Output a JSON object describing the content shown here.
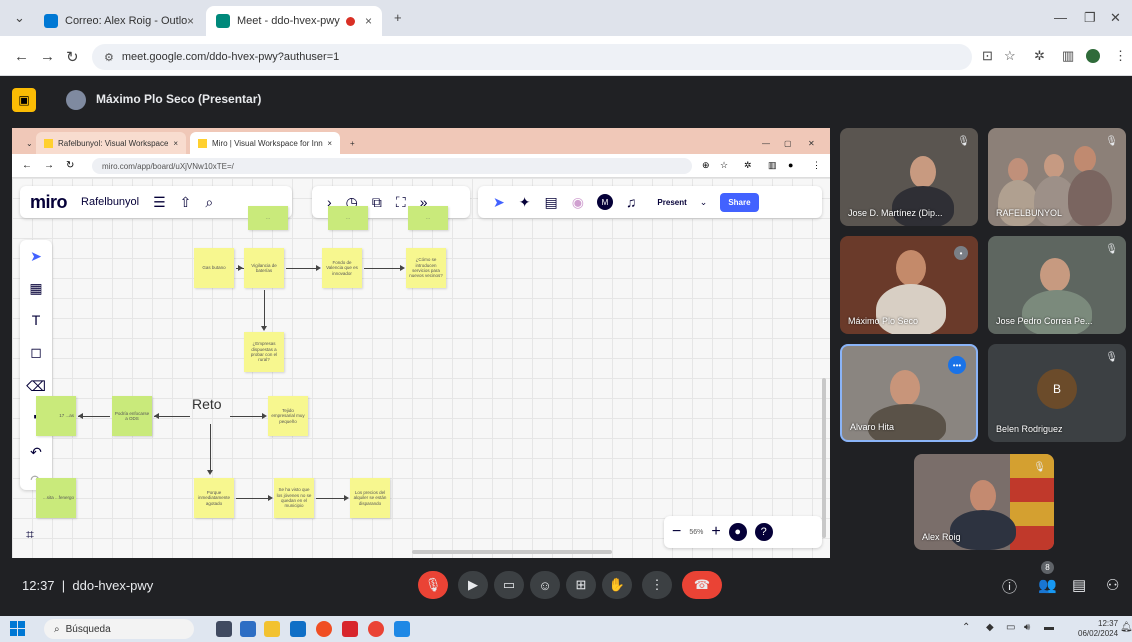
{
  "chrome": {
    "tabs": [
      {
        "label": "Correo: Alex Roig - Outlook",
        "favicon_color": "#0078d4"
      },
      {
        "label": "Meet - ddo-hvex-pwy",
        "favicon_color": "#00897b"
      }
    ],
    "new_tab": "+",
    "url": "meet.google.com/ddo-hvex-pwy?authuser=1",
    "site_info_icon": "tune-icon"
  },
  "meet": {
    "presenter_label": "Máximo Plo Seco (Presentar)",
    "meeting_time": "12:37",
    "meeting_code": "ddo-hvex-pwy",
    "people_count": "8",
    "colors": {
      "background": "#202124",
      "end_call": "#ea4335",
      "speaking": "#1a73e8"
    }
  },
  "shared_screen": {
    "inner_tabs": [
      {
        "label": "Rafelbunyol: Visual Workspace"
      },
      {
        "label": "Miro | Visual Workspace for Inn"
      }
    ],
    "inner_url": "miro.com/app/board/uXjVNw10xTE=/",
    "miro": {
      "logo": "miro",
      "board_name": "Rafelbunyol",
      "present_label": "Present",
      "share_label": "Share",
      "zoom_value": "56%",
      "avatar_letter": "M",
      "reto_label": "Reto",
      "stickies": [
        {
          "id": "s-top1",
          "text": "...",
          "kind": "green"
        },
        {
          "id": "s-top2",
          "text": "...",
          "kind": "green"
        },
        {
          "id": "s-top3",
          "text": "...",
          "kind": "green"
        },
        {
          "id": "s-1",
          "text": "Gas butano",
          "kind": "yellow"
        },
        {
          "id": "s-2",
          "text": "Vigilancia de baterías",
          "kind": "yellow"
        },
        {
          "id": "s-3",
          "text": "Fondo de Valencia que es innovador",
          "kind": "yellow"
        },
        {
          "id": "s-4",
          "text": "¿Cómo se introducen servicios para nuevos vecinos?",
          "kind": "yellow"
        },
        {
          "id": "s-5",
          "text": "¿Empresas dispuestas a probar con el rural?",
          "kind": "yellow"
        },
        {
          "id": "s-6",
          "text": "Podría enfocarse a ODS",
          "kind": "green"
        },
        {
          "id": "s-7",
          "text": "Tejido empresarial muy pequeño",
          "kind": "yellow"
        },
        {
          "id": "s-8",
          "text": "Porque inmediatamente agotado",
          "kind": "yellow"
        },
        {
          "id": "s-9",
          "text": "Se ha visto que los jóvenes no se quedan en el municipio",
          "kind": "yellow"
        },
        {
          "id": "s-10",
          "text": "Los precios del alquiler se están disparando",
          "kind": "yellow"
        },
        {
          "id": "s-11",
          "text": "17 ...as",
          "kind": "green"
        },
        {
          "id": "s-12",
          "text": "...sita ...fenergo",
          "kind": "green"
        }
      ]
    }
  },
  "participants": [
    {
      "name": "Jose D. Martínez (Dip...",
      "muted": true,
      "bg": "#5a5550"
    },
    {
      "name": "RAFELBUNYOL",
      "muted": true,
      "bg": "#8c8078"
    },
    {
      "name": "Máximo Plo Seco",
      "muted": false,
      "bg": "#6a3a2a"
    },
    {
      "name": "Jose Pedro Correa Pe...",
      "muted": true,
      "bg": "#5e6660"
    },
    {
      "name": "Alvaro Hita",
      "muted": false,
      "bg": "#8a8580"
    },
    {
      "name": "Belen Rodriguez",
      "muted": true,
      "bg": "#3c4043",
      "avatar_letter": "B"
    },
    {
      "name": "Alex Roig",
      "muted": true,
      "bg": "#7a6e6a"
    }
  ],
  "taskbar": {
    "search_placeholder": "Búsqueda",
    "clock_time": "12:37",
    "clock_date": "06/02/2024"
  }
}
